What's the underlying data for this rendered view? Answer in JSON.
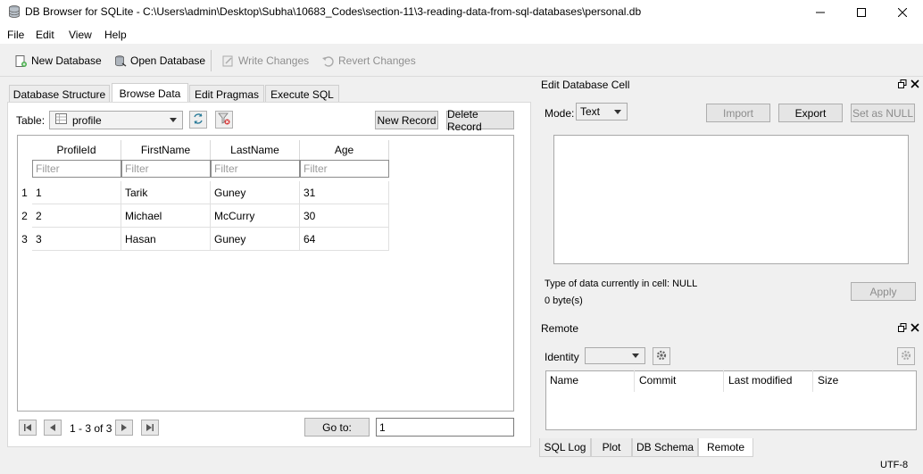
{
  "window": {
    "title": "DB Browser for SQLite - C:\\Users\\admin\\Desktop\\Subha\\10683_Codes\\section-11\\3-reading-data-from-sql-databases\\personal.db"
  },
  "menu": [
    "File",
    "Edit",
    "View",
    "Help"
  ],
  "toolbar": {
    "new_database": "New Database",
    "open_database": "Open Database",
    "write_changes": "Write Changes",
    "revert_changes": "Revert Changes"
  },
  "tabs": [
    "Database Structure",
    "Browse Data",
    "Edit Pragmas",
    "Execute SQL"
  ],
  "browse": {
    "table_label": "Table:",
    "table_value": "profile",
    "new_record": "New Record",
    "delete_record": "Delete Record",
    "columns": [
      "ProfileId",
      "FirstName",
      "LastName",
      "Age"
    ],
    "filter_placeholder": "Filter",
    "rows": [
      {
        "num": "1",
        "cells": [
          "1",
          "Tarik",
          "Guney",
          "31"
        ]
      },
      {
        "num": "2",
        "cells": [
          "2",
          "Michael",
          "McCurry",
          "30"
        ]
      },
      {
        "num": "3",
        "cells": [
          "3",
          "Hasan",
          "Guney",
          "64"
        ]
      }
    ],
    "page_info": "1 - 3 of 3",
    "goto_label": "Go to:",
    "goto_value": "1"
  },
  "edit_cell": {
    "title": "Edit Database Cell",
    "mode_label": "Mode:",
    "mode_value": "Text",
    "import": "Import",
    "export": "Export",
    "set_null": "Set as NULL",
    "type_info": "Type of data currently in cell: NULL",
    "size_info": "0 byte(s)",
    "apply": "Apply"
  },
  "remote": {
    "title": "Remote",
    "identity_label": "Identity",
    "columns": [
      "Name",
      "Commit",
      "Last modified",
      "Size"
    ]
  },
  "bottom_tabs": [
    "SQL Log",
    "Plot",
    "DB Schema",
    "Remote"
  ],
  "status": {
    "encoding": "UTF-8"
  }
}
